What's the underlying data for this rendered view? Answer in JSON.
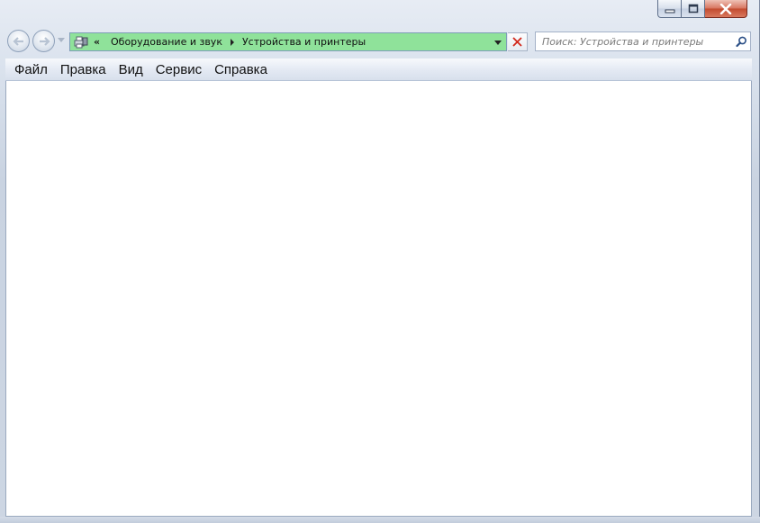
{
  "window": {
    "caption_buttons": [
      {
        "name": "minimize",
        "icon": "minimize-icon"
      },
      {
        "name": "maximize",
        "icon": "maximize-icon"
      },
      {
        "name": "close",
        "icon": "close-icon"
      }
    ]
  },
  "navigation": {
    "back_icon": "back-arrow-icon",
    "forward_icon": "forward-arrow-icon",
    "recent_pages_icon": "chevron-down-icon"
  },
  "address_bar": {
    "background_color": "#8fe29a",
    "location_icon": "devices-printers-icon",
    "overflow_chevron": "«",
    "breadcrumbs": [
      "Оборудование и звук",
      "Устройства и принтеры"
    ]
  },
  "search": {
    "placeholder": "Поиск: Устройства и принтеры",
    "icon": "search-icon"
  },
  "menu": {
    "items": [
      "Файл",
      "Правка",
      "Вид",
      "Сервис",
      "Справка"
    ]
  },
  "colors": {
    "frame": "#dbe3ee",
    "close_button": "#c9533a",
    "content_background": "#ffffff"
  }
}
